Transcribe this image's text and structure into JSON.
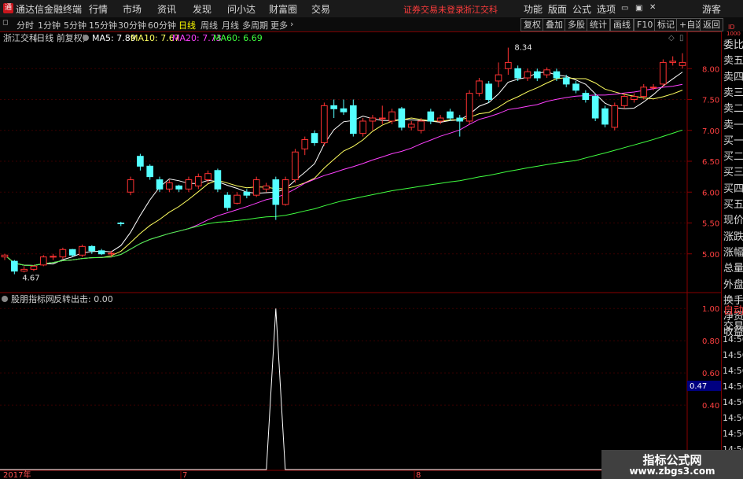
{
  "menubar": {
    "app_title": "通达信金融终端",
    "items": [
      "行情",
      "市场",
      "资讯",
      "发现",
      "问小达",
      "财富圈",
      "交易"
    ],
    "login_notice": "证券交易未登录",
    "stock_name": "浙江交科",
    "right_items": [
      "功能",
      "版面",
      "公式",
      "选项"
    ],
    "guest": "游客",
    "logo_glyph": "通"
  },
  "toolbar": {
    "periods": [
      "分时",
      "1分钟",
      "5分钟",
      "15分钟",
      "30分钟",
      "60分钟",
      "日线",
      "周线",
      "月线",
      "多周期",
      "更多"
    ],
    "selected": "日线",
    "buttons": [
      "复权",
      "叠加",
      "多股",
      "统计",
      "画线",
      "F10",
      "标记",
      "+自选",
      "返回"
    ]
  },
  "main_panel": {
    "title": "浙江交科",
    "subtitle": "(日线 前复权)",
    "ma": [
      {
        "label": "MA5: 7.89",
        "color": "#ffffff"
      },
      {
        "label": "MA10: 7.67",
        "color": "#ffff60"
      },
      {
        "label": "MA20: 7.73",
        "color": "#ff40ff"
      },
      {
        "label": "MA60: 6.69",
        "color": "#40ff40"
      }
    ],
    "price_ticks": [
      "8.00",
      "7.50",
      "7.00",
      "6.50",
      "6.00",
      "5.50",
      "5.00"
    ],
    "high_label": "8.34",
    "low_label": "4.67"
  },
  "sub_panel": {
    "title": "股朋指标网",
    "indicator": "反转出击: 0.00",
    "ticks": [
      "1.00",
      "0.80",
      "0.60",
      "0.40"
    ],
    "current_value": "0.47"
  },
  "xaxis": {
    "labels": [
      "2017年",
      "7",
      "8"
    ]
  },
  "sidepanel": {
    "items": [
      "委比",
      "卖五",
      "卖四",
      "卖三",
      "卖二",
      "卖一",
      "买一",
      "买二",
      "买三",
      "买四",
      "买五",
      "现价",
      "涨跌",
      "涨幅",
      "总量",
      "外盘",
      "换手",
      "净资",
      "收益"
    ],
    "lower_items": [
      "自动",
      "交易"
    ],
    "times": [
      "14:56",
      "14:56",
      "14:56",
      "14:56",
      "14:56",
      "14:56",
      "14:56",
      "14:56"
    ],
    "top_small": "ID",
    "top_small2": "1000"
  },
  "watermark": {
    "line1": "指标公式网",
    "line2": "www.zbgs3.com"
  },
  "chart_data": {
    "type": "candlestick",
    "ylim": [
      4.5,
      8.5
    ],
    "candles": [
      [
        4.95,
        4.98,
        4.9,
        5.0
      ],
      [
        4.88,
        4.72,
        4.67,
        4.9
      ],
      [
        4.72,
        4.75,
        4.7,
        4.8
      ],
      [
        4.75,
        4.8,
        4.72,
        4.82
      ],
      [
        4.82,
        4.95,
        4.8,
        4.98
      ],
      [
        4.95,
        4.96,
        4.9,
        5.0
      ],
      [
        4.95,
        5.07,
        4.92,
        5.1
      ],
      [
        5.07,
        4.98,
        4.95,
        5.08
      ],
      [
        4.98,
        5.12,
        4.95,
        5.15
      ],
      [
        5.12,
        5.05,
        5.0,
        5.14
      ],
      [
        5.05,
        5.0,
        4.98,
        5.08
      ],
      [
        5.0,
        5.01,
        4.95,
        5.05
      ],
      [
        5.5,
        5.49,
        5.45,
        5.52
      ],
      [
        6.0,
        6.2,
        5.95,
        6.25
      ],
      [
        6.58,
        6.42,
        6.35,
        6.62
      ],
      [
        6.42,
        6.25,
        6.2,
        6.45
      ],
      [
        6.2,
        6.05,
        6.0,
        6.25
      ],
      [
        6.05,
        6.15,
        6.0,
        6.2
      ],
      [
        6.1,
        6.05,
        6.0,
        6.12
      ],
      [
        6.05,
        6.2,
        6.0,
        6.25
      ],
      [
        6.1,
        6.25,
        6.05,
        6.3
      ],
      [
        6.2,
        6.3,
        6.15,
        6.35
      ],
      [
        6.35,
        6.05,
        6.0,
        6.38
      ],
      [
        5.95,
        5.75,
        5.7,
        6.0
      ],
      [
        5.82,
        5.95,
        5.8,
        6.0
      ],
      [
        6.0,
        5.95,
        5.9,
        6.05
      ],
      [
        5.95,
        6.2,
        5.92,
        6.25
      ],
      [
        6.05,
        6.1,
        6.0,
        6.15
      ],
      [
        6.2,
        5.8,
        5.55,
        6.25
      ],
      [
        5.8,
        6.2,
        5.78,
        6.25
      ],
      [
        6.2,
        6.65,
        6.15,
        6.7
      ],
      [
        6.7,
        6.85,
        6.6,
        6.9
      ],
      [
        6.95,
        6.8,
        6.75,
        7.0
      ],
      [
        6.8,
        7.4,
        6.75,
        7.45
      ],
      [
        7.4,
        7.35,
        7.2,
        7.5
      ],
      [
        7.35,
        7.3,
        7.25,
        7.5
      ],
      [
        7.4,
        6.95,
        6.9,
        7.5
      ],
      [
        6.95,
        7.15,
        6.9,
        7.2
      ],
      [
        7.15,
        7.2,
        7.0,
        7.25
      ],
      [
        7.2,
        7.2,
        7.1,
        7.4
      ],
      [
        7.15,
        7.3,
        7.1,
        7.35
      ],
      [
        7.35,
        7.05,
        7.0,
        7.38
      ],
      [
        7.05,
        7.1,
        7.0,
        7.15
      ],
      [
        7.0,
        7.15,
        6.95,
        7.2
      ],
      [
        7.3,
        7.15,
        7.1,
        7.35
      ],
      [
        7.15,
        7.2,
        7.1,
        7.25
      ],
      [
        7.3,
        7.2,
        7.15,
        7.35
      ],
      [
        7.2,
        7.15,
        6.9,
        7.25
      ],
      [
        7.15,
        7.6,
        7.1,
        7.65
      ],
      [
        7.6,
        7.8,
        7.55,
        7.85
      ],
      [
        7.75,
        7.5,
        7.45,
        7.8
      ],
      [
        7.8,
        7.9,
        7.7,
        8.1
      ],
      [
        8.0,
        8.1,
        7.9,
        8.34
      ],
      [
        8.0,
        7.85,
        7.8,
        8.05
      ],
      [
        7.85,
        7.95,
        7.8,
        8.0
      ],
      [
        7.95,
        7.85,
        7.8,
        8.0
      ],
      [
        7.9,
        7.98,
        7.85,
        8.02
      ],
      [
        7.95,
        7.85,
        7.8,
        8.0
      ],
      [
        7.85,
        7.75,
        7.7,
        7.9
      ],
      [
        7.75,
        7.65,
        7.6,
        7.8
      ],
      [
        7.6,
        7.5,
        7.45,
        7.65
      ],
      [
        7.55,
        7.2,
        7.15,
        7.6
      ],
      [
        7.35,
        7.1,
        7.05,
        7.4
      ],
      [
        7.05,
        7.4,
        7.0,
        7.45
      ],
      [
        7.4,
        7.55,
        7.35,
        7.6
      ],
      [
        7.5,
        7.55,
        7.45,
        7.6
      ],
      [
        7.55,
        7.7,
        7.5,
        7.75
      ],
      [
        7.7,
        7.7,
        7.65,
        7.75
      ],
      [
        7.75,
        8.1,
        7.7,
        8.15
      ],
      [
        8.1,
        8.12,
        8.05,
        8.2
      ],
      [
        8.05,
        8.1,
        8.0,
        8.25
      ]
    ],
    "ma_series": [
      {
        "name": "MA5",
        "color": "#ffffff"
      },
      {
        "name": "MA10",
        "color": "#ffff60"
      },
      {
        "name": "MA20",
        "color": "#ff40ff"
      },
      {
        "name": "MA60",
        "color": "#40ff40"
      }
    ],
    "indicator": {
      "name": "反转出击",
      "spike_index": 28,
      "spike_value": 1.0,
      "ylim": [
        0,
        1.05
      ]
    }
  }
}
